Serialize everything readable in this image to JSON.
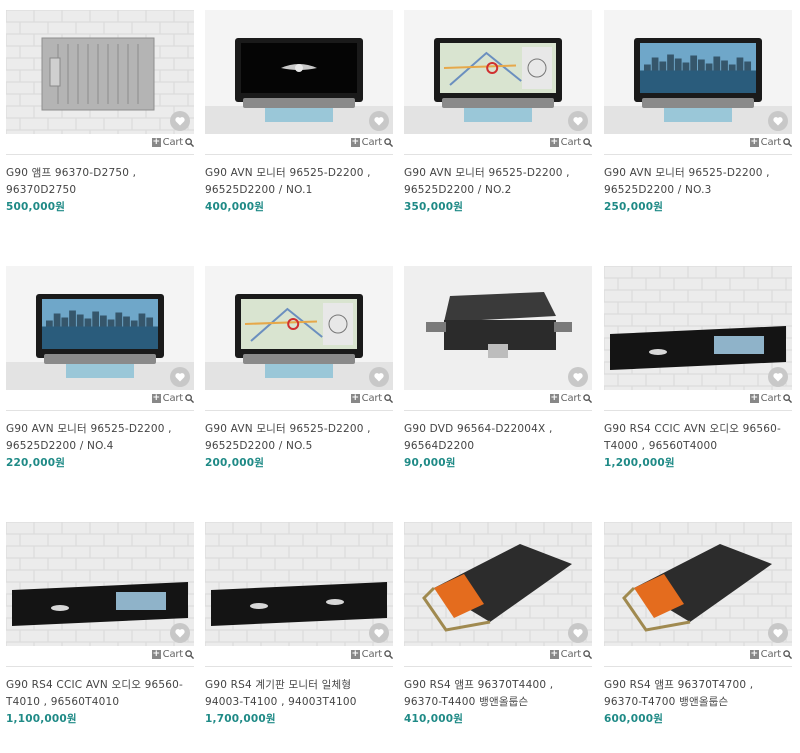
{
  "cart_label": "Cart",
  "products": [
    {
      "title": "G90 앰프 96370-D2750 , 96370D2750",
      "price": "500,000원",
      "image": "amp-silver"
    },
    {
      "title": "G90 AVN 모니터 96525-D2200 , 96525D2200 / NO.1",
      "price": "400,000원",
      "image": "monitor-logo"
    },
    {
      "title": "G90 AVN 모니터 96525-D2200 , 96525D2200 / NO.2",
      "price": "350,000원",
      "image": "monitor-map"
    },
    {
      "title": "G90 AVN 모니터 96525-D2200 , 96525D2200 / NO.3",
      "price": "250,000원",
      "image": "monitor-city"
    },
    {
      "title": "G90 AVN 모니터 96525-D2200 , 96525D2200 / NO.4",
      "price": "220,000원",
      "image": "monitor-city"
    },
    {
      "title": "G90 AVN 모니터 96525-D2200 , 96525D2200 / NO.5",
      "price": "200,000원",
      "image": "monitor-map"
    },
    {
      "title": "G90 DVD 96564-D22004X , 96564D2200",
      "price": "90,000원",
      "image": "dvd-unit"
    },
    {
      "title": "G90 RS4 CCIC AVN 오디오 96560-T4000 , 96560T4000",
      "price": "1,200,000원",
      "image": "wide-display"
    },
    {
      "title": "G90 RS4 CCIC AVN 오디오 96560-T4010 , 96560T4010",
      "price": "1,100,000원",
      "image": "wide-display"
    },
    {
      "title": "G90 RS4 계기판 모니터 일체형 94003-T4100 , 94003T4100",
      "price": "1,700,000원",
      "image": "wide-display-dark"
    },
    {
      "title": "G90 RS4 앰프 96370T4400 , 96370-T4400 뱅앤올룹슨",
      "price": "410,000원",
      "image": "amp-orange"
    },
    {
      "title": "G90 RS4 앰프 96370T4700 , 96370-T4700 뱅앤올룹슨",
      "price": "600,000원",
      "image": "amp-orange"
    }
  ],
  "colors": {
    "price": "#1f8a86",
    "heart_bg": "#c8c8c8"
  }
}
